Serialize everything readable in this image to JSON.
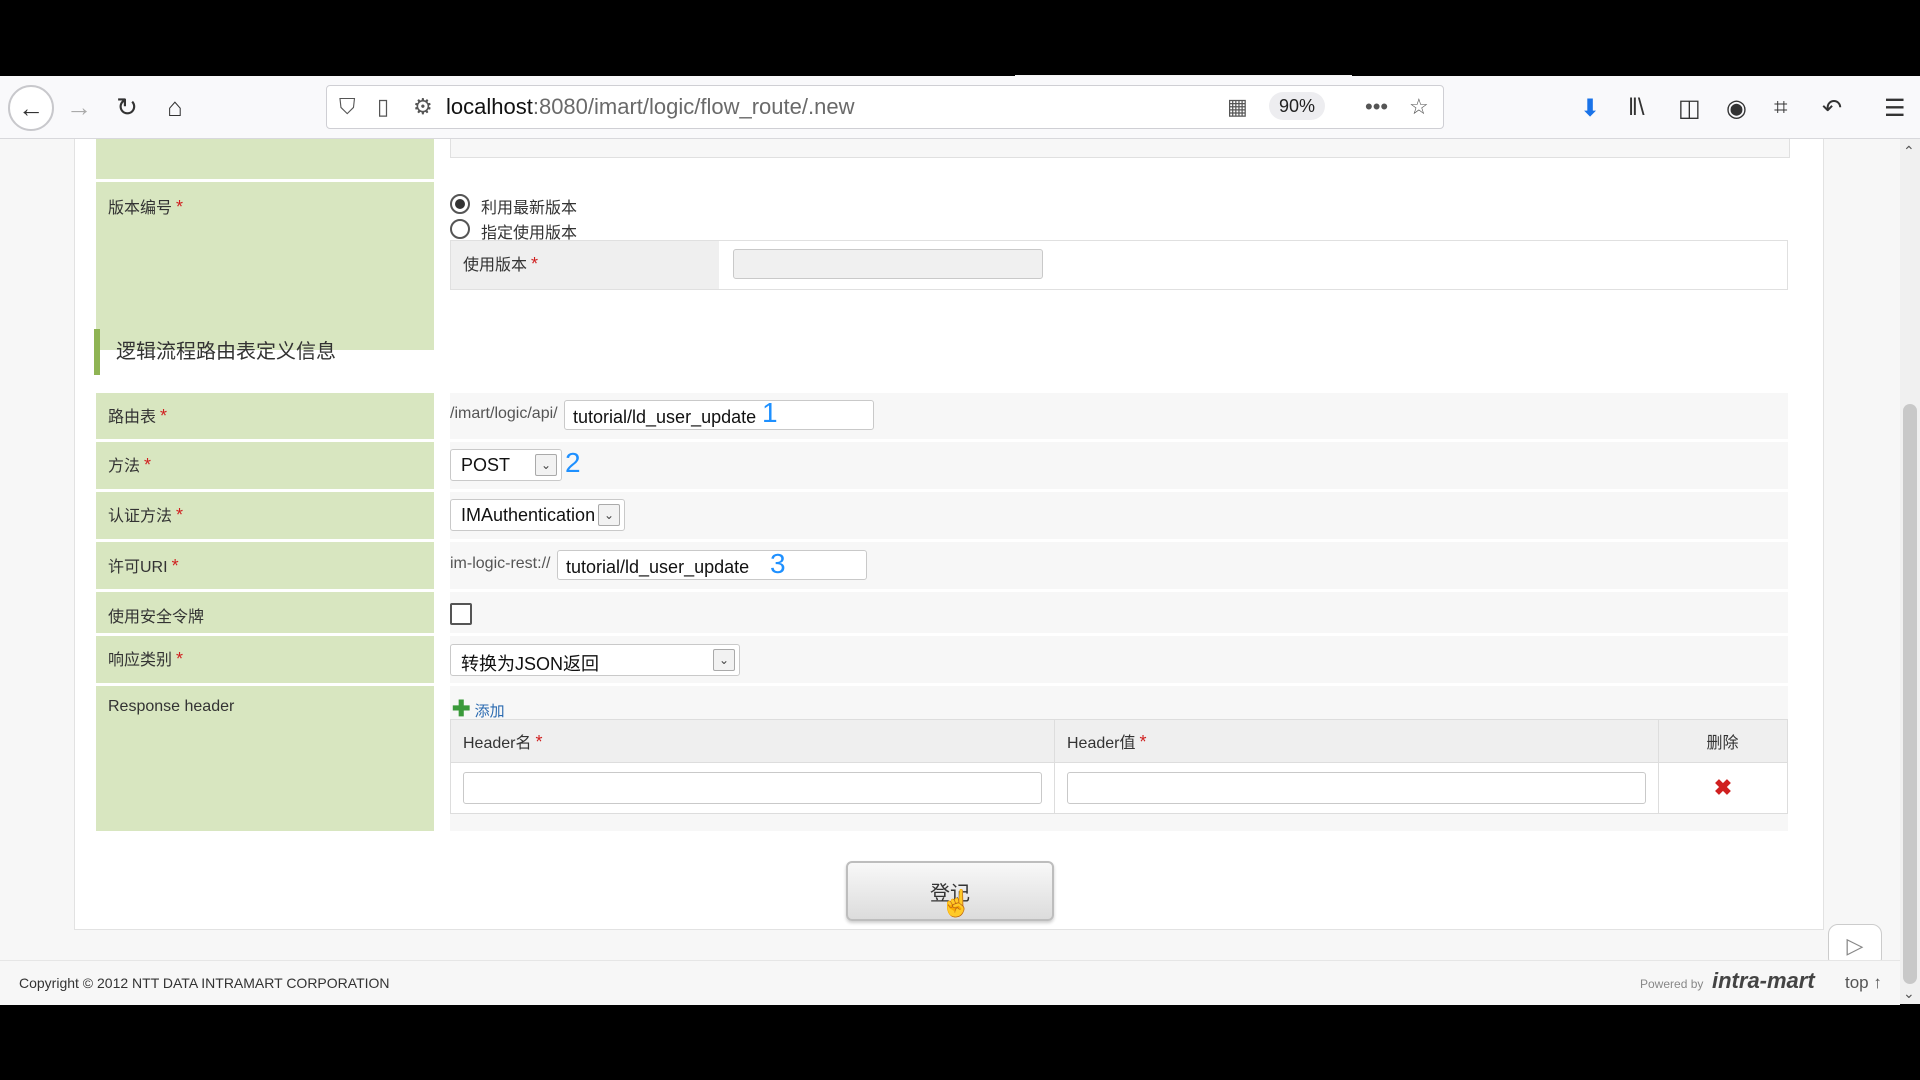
{
  "browser": {
    "url_host": "localhost",
    "url_path": ":8080/imart/logic/flow_route/.new",
    "zoom": "90%",
    "icons": [
      "back-arrow-icon",
      "forward-arrow-icon",
      "reload-icon",
      "home-icon",
      "shield-icon",
      "page-icon",
      "permissions-icon",
      "qr-code-icon",
      "more-icon",
      "star-icon",
      "download-icon",
      "library-icon",
      "sidebar-icon",
      "account-icon",
      "screenshot-icon",
      "undo-icon",
      "menu-icon"
    ]
  },
  "version": {
    "label": "版本编号",
    "option_latest": "利用最新版本",
    "option_specific": "指定使用版本",
    "use_version_label": "使用版本",
    "use_version_value": ""
  },
  "section_title": "逻辑流程路由表定义信息",
  "route": {
    "label": "路由表",
    "prefix": "/imart/logic/api/",
    "value": "tutorial/ld_user_update",
    "annotation": "1"
  },
  "method": {
    "label": "方法",
    "value": "POST",
    "annotation": "2"
  },
  "auth": {
    "label": "认证方法",
    "value": "IMAuthentication"
  },
  "permit_uri": {
    "label": "许可URI",
    "prefix": "im-logic-rest://",
    "value": "tutorial/ld_user_update",
    "annotation": "3"
  },
  "security_token": {
    "label": "使用安全令牌",
    "checked": false
  },
  "response_type": {
    "label": "响应类别",
    "value": "转换为JSON返回"
  },
  "response_header": {
    "label": "Response header",
    "add_label": "添加",
    "columns": [
      "Header名",
      "Header值",
      "删除"
    ],
    "rows": [
      {
        "name": "",
        "value": ""
      }
    ]
  },
  "submit_label": "登记",
  "footer": {
    "copyright": "Copyright © 2012 NTT DATA INTRAMART CORPORATION",
    "powered_by": "Powered by",
    "brand": "intra-mart",
    "top_link": "top ↑"
  },
  "colors": {
    "label_bg": "#d8e6c0",
    "section_accent": "#8fb454",
    "required": "#d02020",
    "annotation": "#1e90ff"
  }
}
